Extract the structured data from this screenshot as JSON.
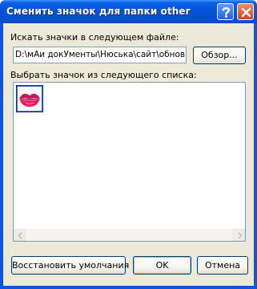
{
  "window": {
    "title": "Сменить значок для папки other",
    "help_icon": "help-icon",
    "close_icon": "close-icon"
  },
  "file_section": {
    "label": "Искать значки в следующем файле:",
    "path_value": "D:\\мАи докУменты\\Нюська\\сайт\\обновки",
    "browse_label": "Обзор..."
  },
  "list_section": {
    "label": "Выбрать значок из следующего списка:",
    "items": [
      {
        "icon": "lips-icon",
        "selected": true
      }
    ]
  },
  "buttons": {
    "restore_label": "Восстановить умолчания",
    "ok_label": "OK",
    "cancel_label": "Отмена"
  },
  "colors": {
    "titlebar": "#0553d9",
    "dialog_bg": "#ece9d8",
    "selection": "#316ac5",
    "default_button_outline": "#f0b050"
  }
}
